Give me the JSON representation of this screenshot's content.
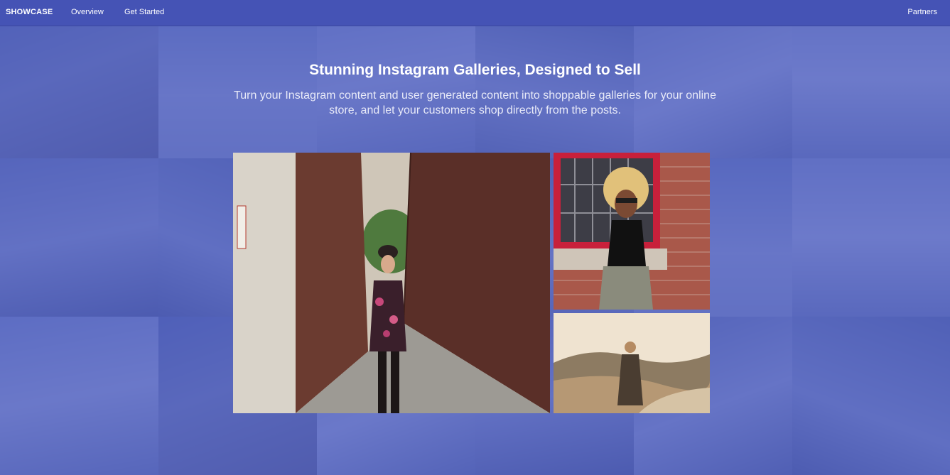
{
  "nav": {
    "brand": "SHOWCASE",
    "links": [
      "Overview",
      "Get Started"
    ],
    "right_link": "Partners"
  },
  "hero": {
    "title": "Stunning Instagram Galleries, Designed to Sell",
    "subtitle": "Turn your Instagram content and user generated content into shoppable galleries for your online store, and let your customers shop directly from the posts."
  },
  "colors": {
    "header_bg": "#4553b5",
    "overlay": "#4858be",
    "text": "#ffffff"
  }
}
